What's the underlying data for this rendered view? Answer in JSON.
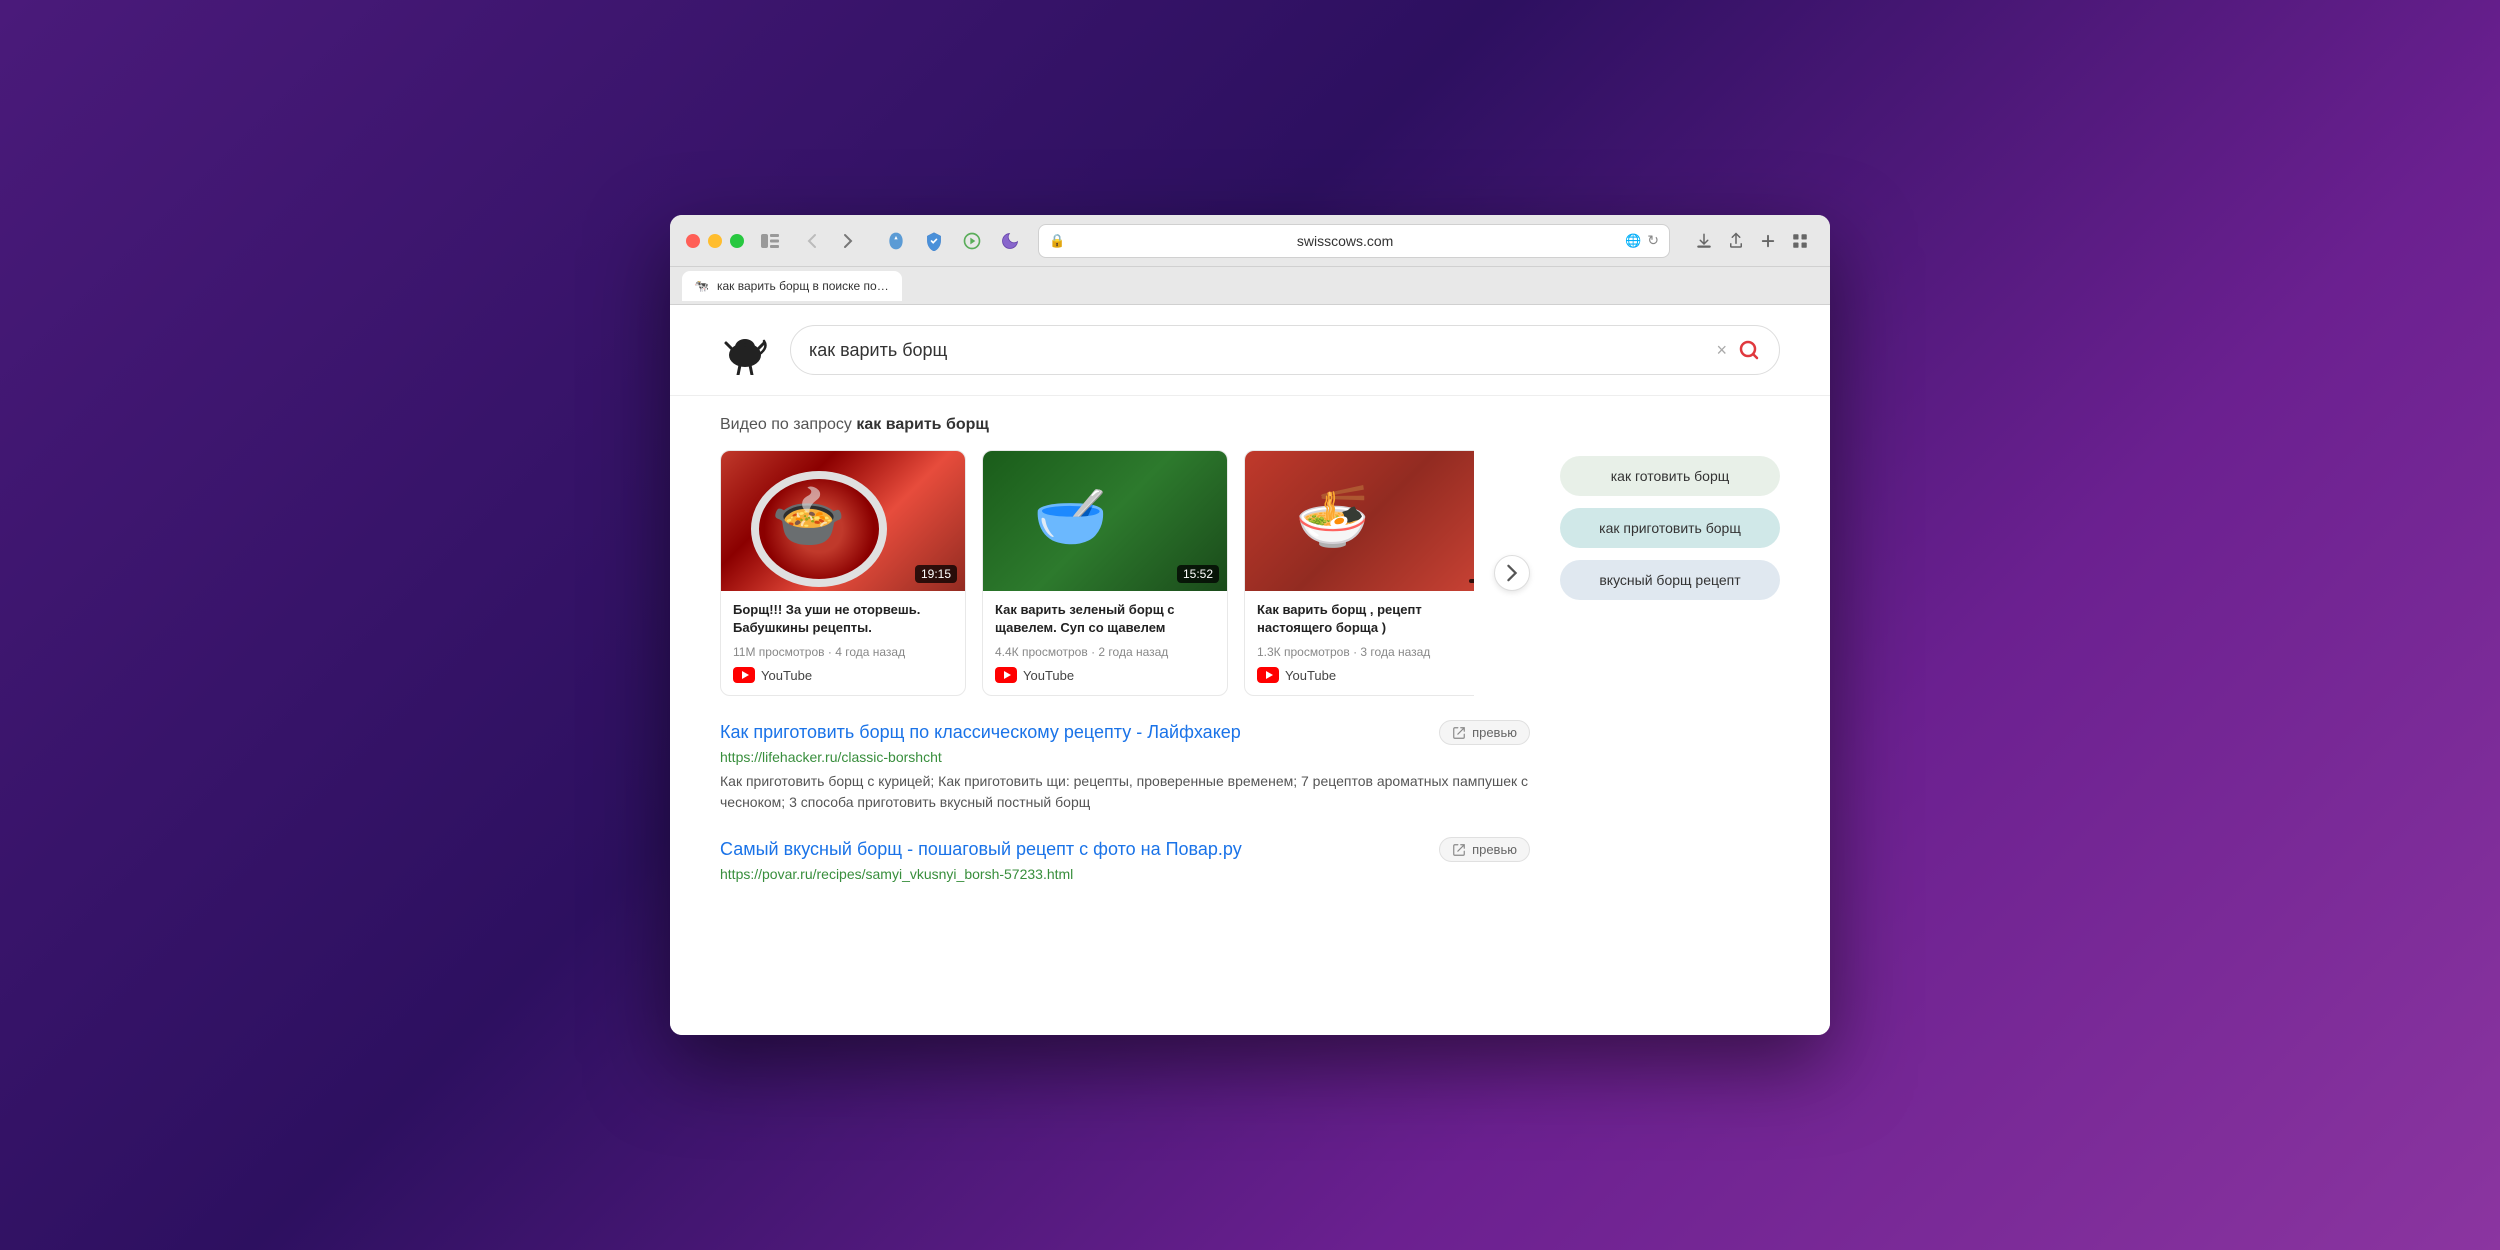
{
  "window": {
    "title": "как варить борщ в поиске по разделу Веб - Swisscows"
  },
  "browser": {
    "url": "swisscows.com",
    "tab_label": "как варить борщ в поиске...",
    "back_icon": "‹",
    "forward_icon": "›",
    "reload_icon": "↻",
    "lock_icon": "🔒",
    "download_icon": "⬇",
    "share_icon": "⬆",
    "new_tab_icon": "+",
    "grid_icon": "⊞",
    "sidebar_icon": "▤"
  },
  "search": {
    "query": "как варить борщ",
    "placeholder": "как варить борщ",
    "clear_label": "×",
    "submit_label": "🔍"
  },
  "videos_section": {
    "prefix": "Видео по запросу ",
    "query_bold": "как варить борщ",
    "next_arrow": "›",
    "videos": [
      {
        "title": "Борщ!!! За уши не оторвешь. Бабушкины рецепты.",
        "duration": "19:15",
        "views": "11М просмотров",
        "age": "4 года назад",
        "source": "YouTube",
        "thumb_class": "thumb-1"
      },
      {
        "title": "Как варить зеленый борщ с щавелем. Суп со щавелем",
        "duration": "15:52",
        "views": "4.4К просмотров",
        "age": "2 года назад",
        "source": "YouTube",
        "thumb_class": "thumb-2"
      },
      {
        "title": "Как варить борщ , рецепт настоящего борща )",
        "duration": "",
        "views": "1.3К просмотров",
        "age": "3 года назад",
        "source": "YouTube",
        "thumb_class": "thumb-3"
      }
    ]
  },
  "web_results": [
    {
      "title": "Как приготовить борщ по классическому рецепту - Лайфхакер",
      "url": "https://lifehacker.ru/classic-borshcht",
      "snippet": "Как приготовить борщ с курицей; Как приготовить щи: рецепты, проверенные временем; 7 рецептов ароматных пампушек с чесноком; 3 способа приготовить вкусный постный борщ",
      "preview_label": "превью"
    },
    {
      "title": "Самый вкусный борщ - пошаговый рецепт с фото на Повар.ру",
      "url": "https://povar.ru/recipes/samyi_vkusnyi_borsh-57233.html",
      "snippet": "",
      "preview_label": "превью"
    }
  ],
  "sidebar": {
    "suggestions": [
      {
        "label": "как готовить борщ",
        "color_class": "sug-1"
      },
      {
        "label": "как приготовить борщ",
        "color_class": "sug-2"
      },
      {
        "label": "вкусный борщ рецепт",
        "color_class": "sug-3"
      }
    ]
  },
  "icons": {
    "shield_blue": "🛡",
    "shield_check": "✓",
    "play_icon": "▷",
    "moon_icon": "🌙",
    "doc_icon": "📄",
    "link_icon": "🔗"
  }
}
